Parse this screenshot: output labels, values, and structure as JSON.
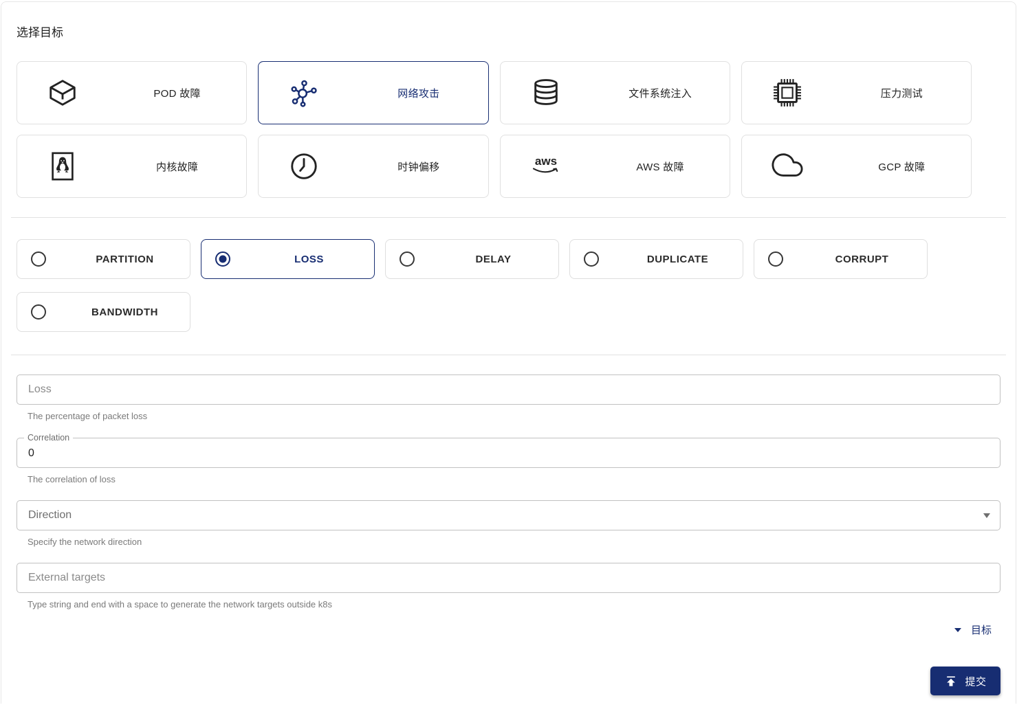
{
  "title": "选择目标",
  "targets": [
    {
      "label": "POD 故障",
      "icon": "pod-cube-icon",
      "selected": false
    },
    {
      "label": "网络攻击",
      "icon": "network-icon",
      "selected": true
    },
    {
      "label": "文件系统注入",
      "icon": "filesystem-icon",
      "selected": false
    },
    {
      "label": "压力测试",
      "icon": "cpu-icon",
      "selected": false
    },
    {
      "label": "内核故障",
      "icon": "linux-icon",
      "selected": false
    },
    {
      "label": "时钟偏移",
      "icon": "clock-icon",
      "selected": false
    },
    {
      "label": "AWS 故障",
      "icon": "aws-icon",
      "selected": false
    },
    {
      "label": "GCP 故障",
      "icon": "cloud-icon",
      "selected": false
    }
  ],
  "actions": [
    {
      "label": "PARTITION",
      "selected": false
    },
    {
      "label": "LOSS",
      "selected": true
    },
    {
      "label": "DELAY",
      "selected": false
    },
    {
      "label": "DUPLICATE",
      "selected": false
    },
    {
      "label": "CORRUPT",
      "selected": false
    },
    {
      "label": "BANDWIDTH",
      "selected": false
    }
  ],
  "form": {
    "loss": {
      "placeholder": "Loss",
      "helper": "The percentage of packet loss"
    },
    "correlation": {
      "label": "Correlation",
      "value": "0",
      "helper": "The correlation of loss"
    },
    "direction": {
      "label": "Direction",
      "helper": "Specify the network direction"
    },
    "external": {
      "placeholder": "External targets",
      "helper": "Type string and end with a space to generate the network targets outside k8s"
    }
  },
  "scope": {
    "toggle_label": "目标"
  },
  "submit": {
    "label": "提交",
    "icon": "publish-icon"
  },
  "colors": {
    "primary": "#172d72",
    "card_border": "#e0e0e0",
    "input_border": "#c1c1c1",
    "divider": "#e2e2e2"
  }
}
